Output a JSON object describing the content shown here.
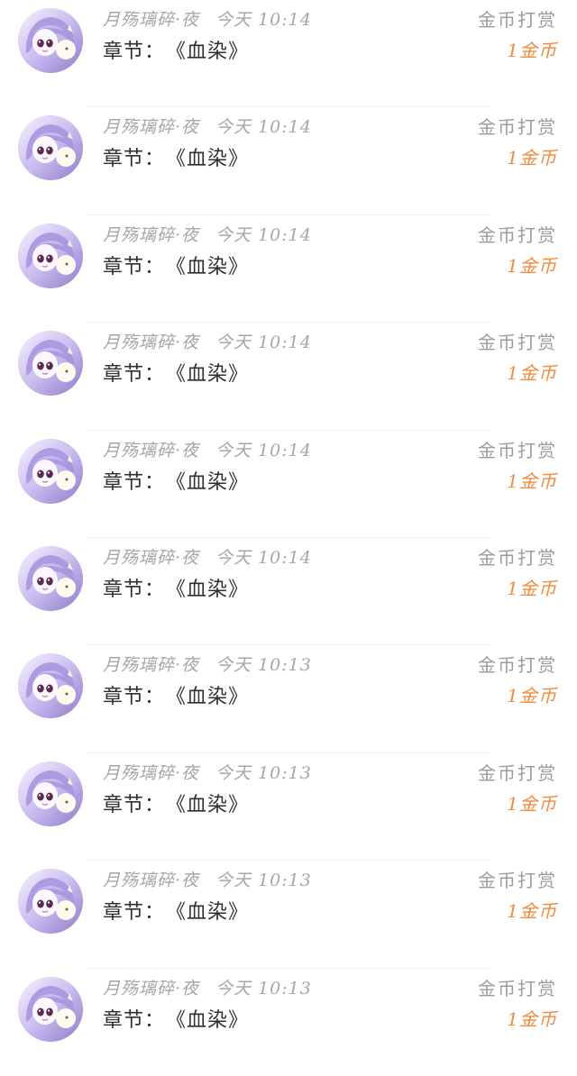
{
  "items": [
    {
      "name": "月殇璃碎·夜",
      "time": "今天 10:14",
      "chapter_label": "章节：",
      "chapter_title": "《血染》",
      "reward_label": "金币打赏",
      "reward_amount": "1金币"
    },
    {
      "name": "月殇璃碎·夜",
      "time": "今天 10:14",
      "chapter_label": "章节：",
      "chapter_title": "《血染》",
      "reward_label": "金币打赏",
      "reward_amount": "1金币"
    },
    {
      "name": "月殇璃碎·夜",
      "time": "今天 10:14",
      "chapter_label": "章节：",
      "chapter_title": "《血染》",
      "reward_label": "金币打赏",
      "reward_amount": "1金币"
    },
    {
      "name": "月殇璃碎·夜",
      "time": "今天 10:14",
      "chapter_label": "章节：",
      "chapter_title": "《血染》",
      "reward_label": "金币打赏",
      "reward_amount": "1金币"
    },
    {
      "name": "月殇璃碎·夜",
      "time": "今天 10:14",
      "chapter_label": "章节：",
      "chapter_title": "《血染》",
      "reward_label": "金币打赏",
      "reward_amount": "1金币"
    },
    {
      "name": "月殇璃碎·夜",
      "time": "今天 10:14",
      "chapter_label": "章节：",
      "chapter_title": "《血染》",
      "reward_label": "金币打赏",
      "reward_amount": "1金币"
    },
    {
      "name": "月殇璃碎·夜",
      "time": "今天 10:13",
      "chapter_label": "章节：",
      "chapter_title": "《血染》",
      "reward_label": "金币打赏",
      "reward_amount": "1金币"
    },
    {
      "name": "月殇璃碎·夜",
      "time": "今天 10:13",
      "chapter_label": "章节：",
      "chapter_title": "《血染》",
      "reward_label": "金币打赏",
      "reward_amount": "1金币"
    },
    {
      "name": "月殇璃碎·夜",
      "time": "今天 10:13",
      "chapter_label": "章节：",
      "chapter_title": "《血染》",
      "reward_label": "金币打赏",
      "reward_amount": "1金币"
    },
    {
      "name": "月殇璃碎·夜",
      "time": "今天 10:13",
      "chapter_label": "章节：",
      "chapter_title": "《血染》",
      "reward_label": "金币打赏",
      "reward_amount": "1金币"
    }
  ],
  "avatar_icon": "anime-avatar",
  "colors": {
    "meta_text": "#a6a6a6",
    "chapter_text": "#2f2f2f",
    "reward_label": "#9b9b9b",
    "reward_amount": "#f08a3c",
    "divider": "#ededed"
  }
}
